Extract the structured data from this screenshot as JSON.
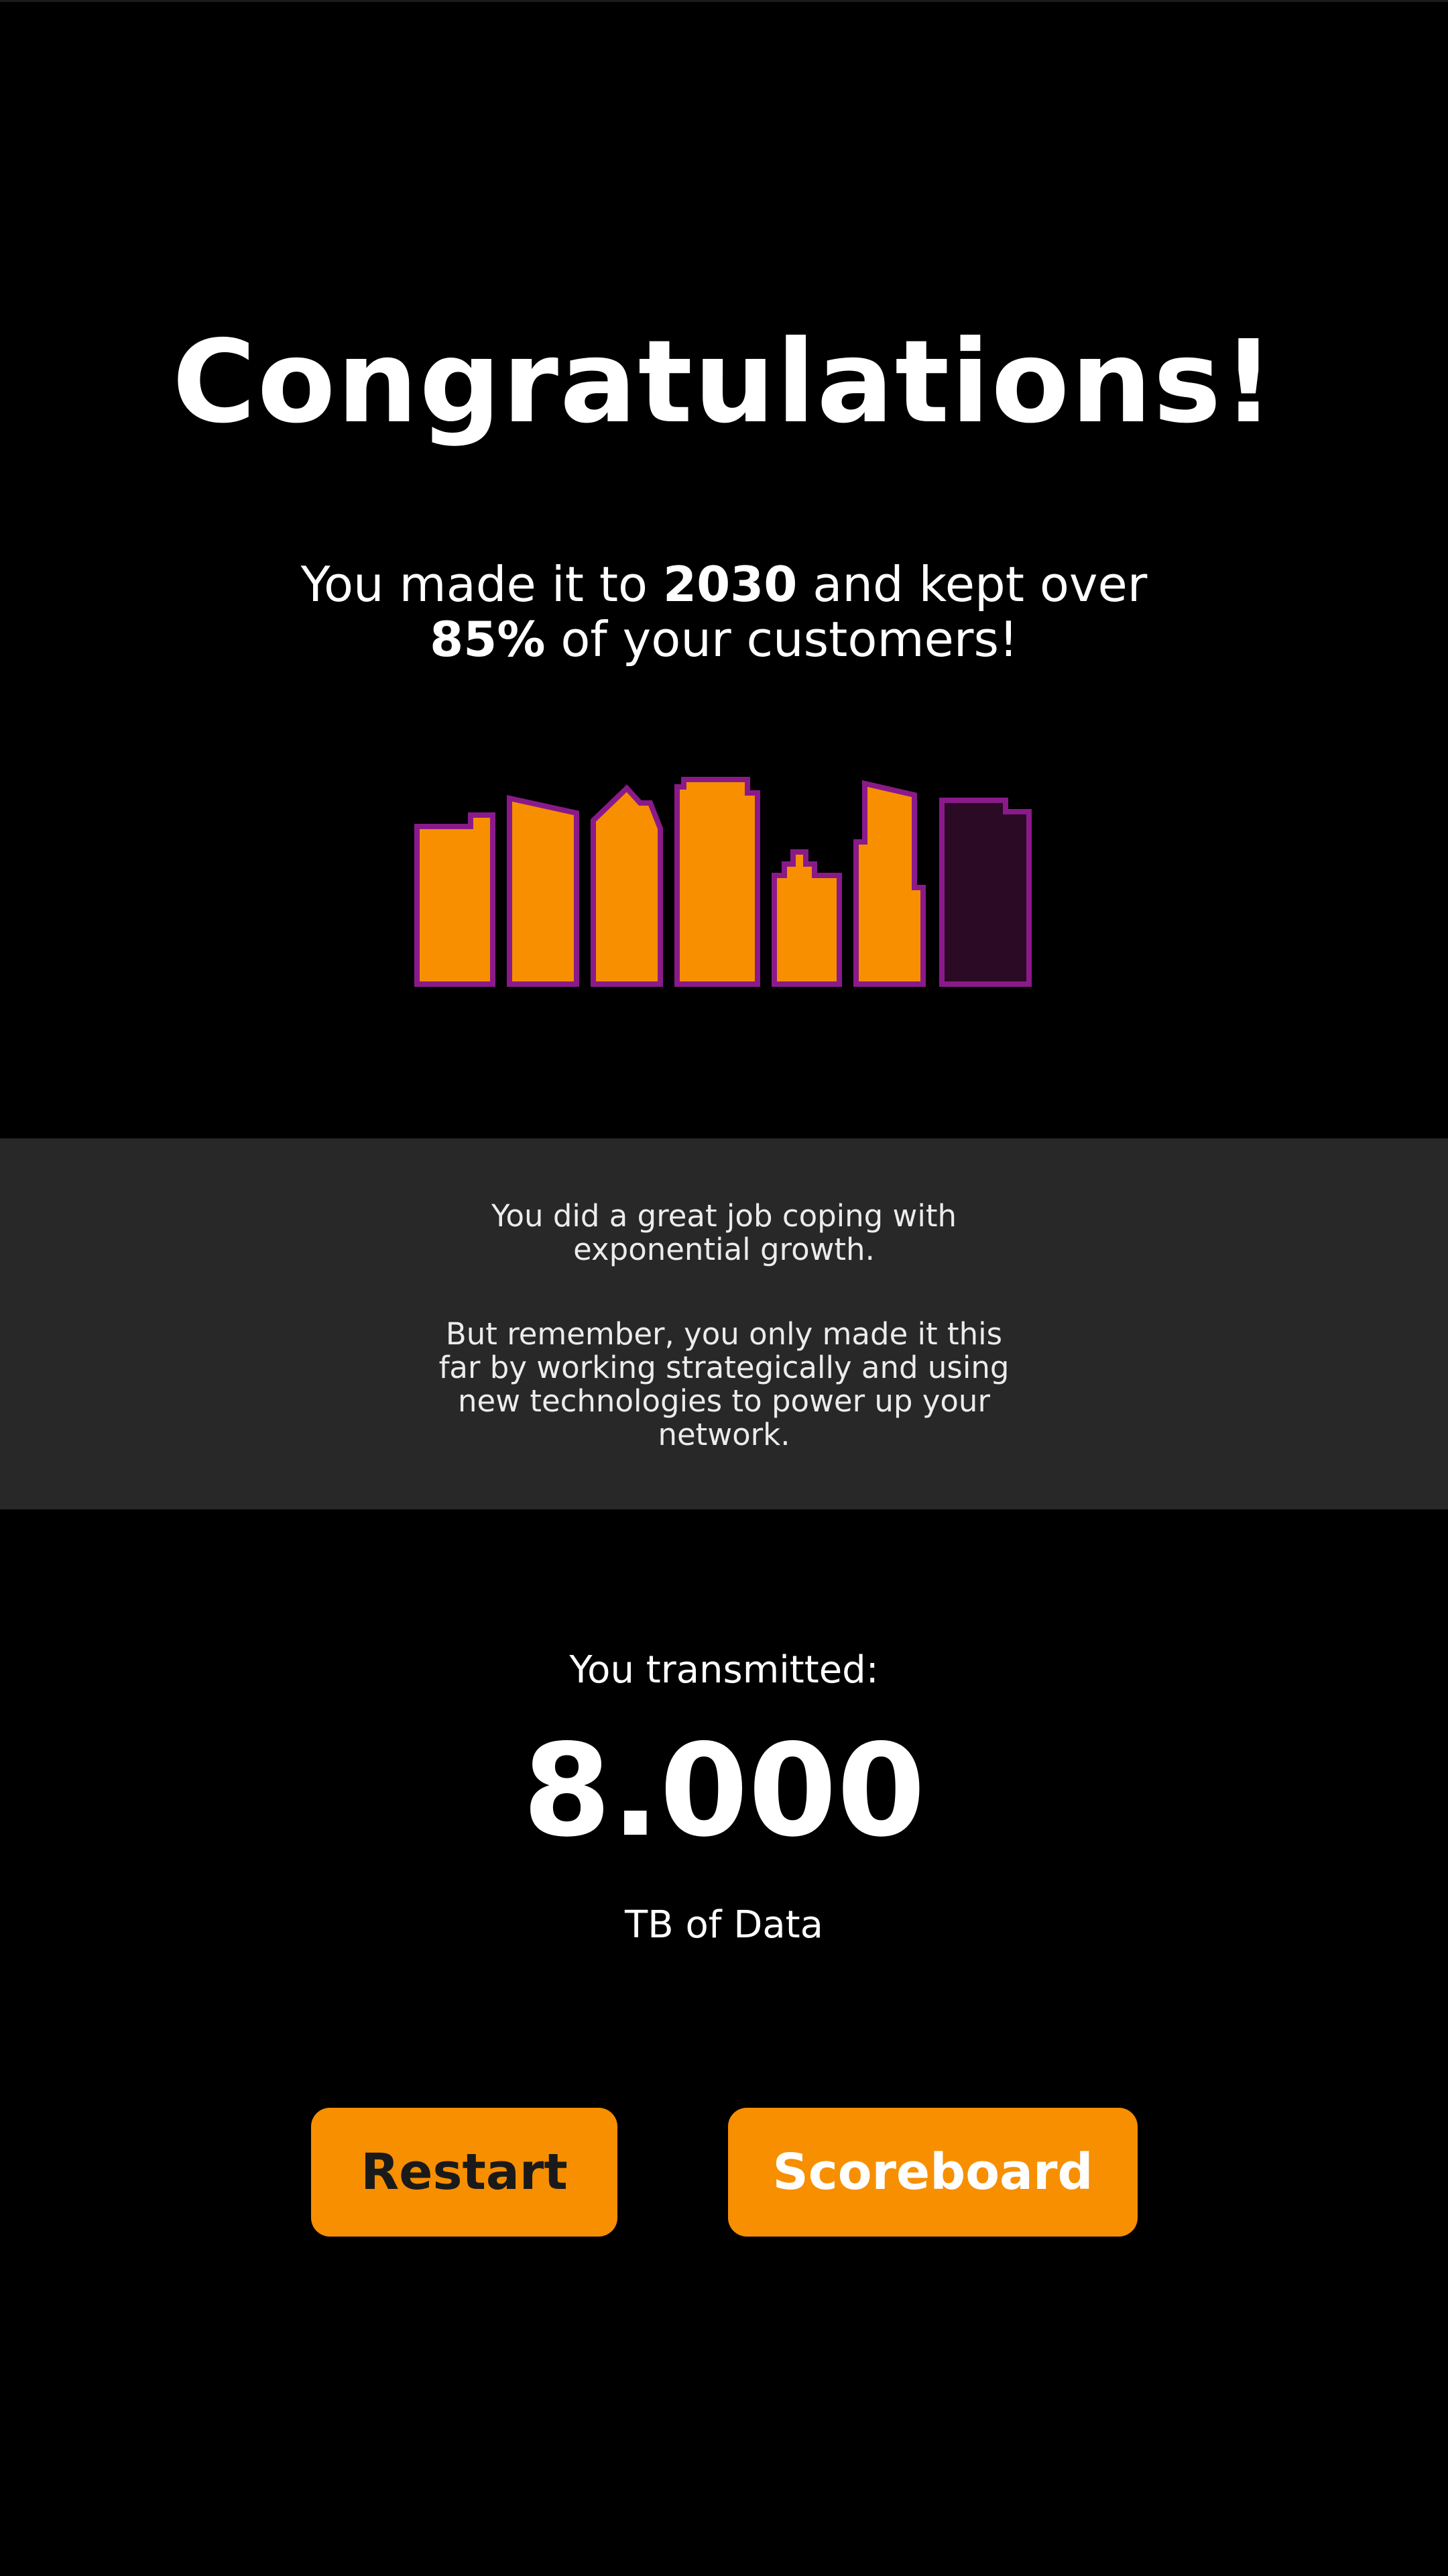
{
  "screen": {
    "title": "Congratulations!",
    "subtitle_line1_pre": "You made it to ",
    "subtitle_year": "2030",
    "subtitle_line1_post": " and kept over",
    "subtitle_percent": "85%",
    "subtitle_line2_post": " of your customers!"
  },
  "skyline": {
    "fill_color": "#f78f00",
    "outline_color": "#8a1a8a",
    "dark_fill_color": "#2b0a26",
    "lit_buildings": 6,
    "total_buildings": 7
  },
  "info": {
    "paragraph1": "You did a great job coping with exponential growth.",
    "paragraph2": "But remember, you only made it this far by working strategically and using new technologies to power up your network."
  },
  "result": {
    "label": "You transmitted:",
    "value": "8.000",
    "unit": "TB of Data"
  },
  "buttons": {
    "restart": "Restart",
    "scoreboard": "Scoreboard"
  },
  "colors": {
    "background": "#000000",
    "band": "#282828",
    "accent": "#f78f00"
  }
}
